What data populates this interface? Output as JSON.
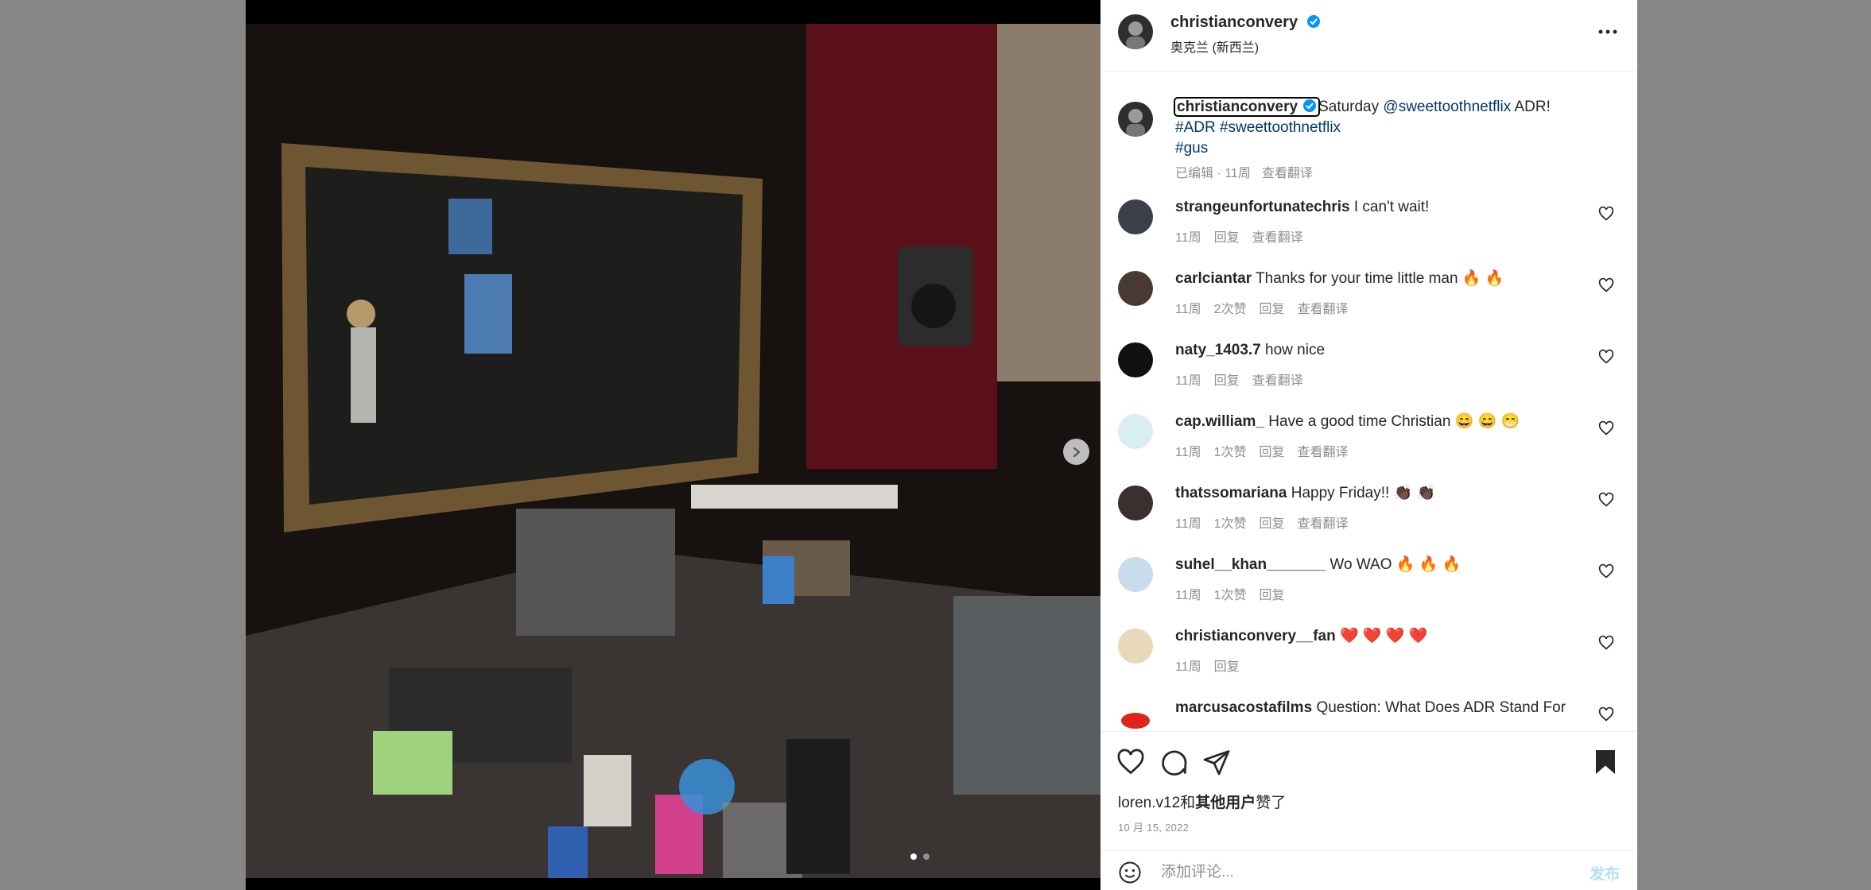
{
  "post": {
    "author": "christianconvery",
    "location": "奥克兰 (新西兰)"
  },
  "caption": {
    "author": "christianconvery",
    "text_plain": "Saturday ",
    "mention": "@sweettoothnetflix",
    "text_tail": " ADR!",
    "hashtags_line1": "#ADR #sweettoothnetflix",
    "hashtag_line2": "#gus",
    "edited": "已编辑 · 11周",
    "translate": "查看翻译"
  },
  "comments": [
    {
      "user": "strangeunfortunatechris",
      "text": "I can't wait!",
      "time": "11周",
      "likes": "",
      "reply": "回复",
      "translate": "查看翻译"
    },
    {
      "user": "carlciantar",
      "text": "Thanks for your time little man 🔥 🔥",
      "time": "11周",
      "likes": "2次赞",
      "reply": "回复",
      "translate": "查看翻译"
    },
    {
      "user": "naty_1403.7",
      "text": "how nice",
      "time": "11周",
      "likes": "",
      "reply": "回复",
      "translate": "查看翻译"
    },
    {
      "user": "cap.william_",
      "text": "Have a good time Christian 😄 😄 😁",
      "time": "11周",
      "likes": "1次赞",
      "reply": "回复",
      "translate": "查看翻译"
    },
    {
      "user": "thatssomariana",
      "text": "Happy Friday!! 👏🏿 👏🏿",
      "time": "11周",
      "likes": "1次赞",
      "reply": "回复",
      "translate": "查看翻译"
    },
    {
      "user": "suhel__khan_______",
      "text": "Wo WAO 🔥 🔥 🔥",
      "time": "11周",
      "likes": "1次赞",
      "reply": "回复",
      "translate": ""
    },
    {
      "user": "christianconvery__fan",
      "text": "❤️ ❤️ ❤️ ❤️",
      "time": "11周",
      "likes": "",
      "reply": "回复",
      "translate": ""
    },
    {
      "user": "marcusacostafilms",
      "text": "Question: What Does ADR Stand For",
      "time": "",
      "likes": "",
      "reply": "",
      "translate": ""
    }
  ],
  "likes_line": {
    "user": "loren.v12",
    "connector": "和",
    "others": "其他用户",
    "suffix": "赞了"
  },
  "date": "10 月 15, 2022",
  "composer": {
    "placeholder": "添加评论...",
    "post_label": "发布"
  },
  "colors": {
    "link": "#00376b",
    "verified": "#0095f6",
    "post_disabled": "#b2dffc"
  }
}
